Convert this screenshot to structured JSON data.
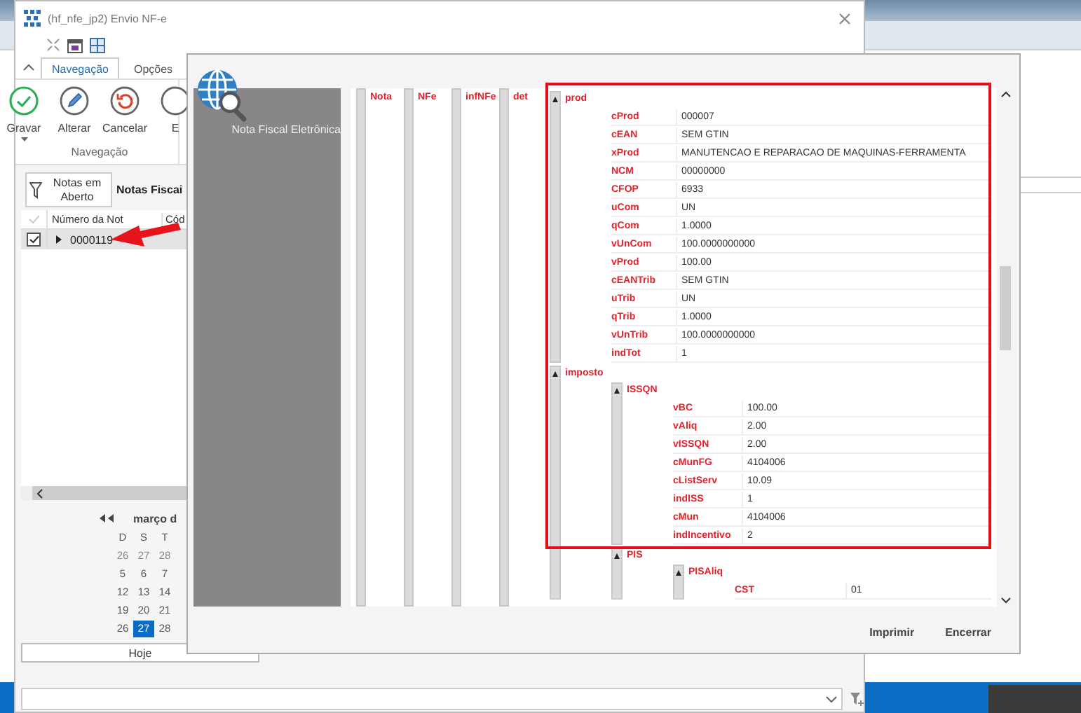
{
  "app_window": {
    "title": "(hf_nfe_jp2)  Envio NF-e"
  },
  "ribbon": {
    "tabs": [
      {
        "label": "Navegação",
        "selected": true
      },
      {
        "label": "Opções",
        "selected": false
      }
    ],
    "buttons": [
      {
        "label": "Gravar",
        "kind": "check",
        "dropdown": true
      },
      {
        "label": "Alterar",
        "kind": "pencil",
        "dropdown": false
      },
      {
        "label": "Cancelar",
        "kind": "undo",
        "dropdown": false
      },
      {
        "label": "E",
        "kind": "circle",
        "dropdown": false
      }
    ],
    "group_label": "Navegação"
  },
  "filter_button": "Notas em Aberto",
  "grid": {
    "title": "Notas Fiscai",
    "columns": [
      "Número da Not",
      "Cód"
    ],
    "rows": [
      {
        "checked": true,
        "selected": true,
        "number": "0000119"
      }
    ]
  },
  "calendar": {
    "month": "março d",
    "weekdays": [
      "D",
      "S",
      "T"
    ],
    "weeks": [
      [
        {
          "day": "26",
          "other_month": true,
          "selected": false
        },
        {
          "day": "27",
          "other_month": true,
          "selected": false
        },
        {
          "day": "28",
          "other_month": true,
          "selected": false
        }
      ],
      [
        {
          "day": "5",
          "other_month": false,
          "selected": false
        },
        {
          "day": "6",
          "other_month": false,
          "selected": false
        },
        {
          "day": "7",
          "other_month": false,
          "selected": false
        }
      ],
      [
        {
          "day": "12",
          "other_month": false,
          "selected": false
        },
        {
          "day": "13",
          "other_month": false,
          "selected": false
        },
        {
          "day": "14",
          "other_month": false,
          "selected": false
        }
      ],
      [
        {
          "day": "19",
          "other_month": false,
          "selected": false
        },
        {
          "day": "20",
          "other_month": false,
          "selected": false
        },
        {
          "day": "21",
          "other_month": false,
          "selected": false
        }
      ],
      [
        {
          "day": "26",
          "other_month": false,
          "selected": false
        },
        {
          "day": "27",
          "other_month": false,
          "selected": true
        },
        {
          "day": "28",
          "other_month": false,
          "selected": false
        }
      ]
    ]
  },
  "today_button": "Hoje",
  "dialog": {
    "heading": "Nota Fiscal Eletrônica",
    "path": [
      "Nota",
      "NFe",
      "infNFe",
      "det"
    ],
    "tree": [
      {
        "name": "prod",
        "expanded": true,
        "fields": [
          {
            "key": "cProd",
            "value": "000007"
          },
          {
            "key": "cEAN",
            "value": "SEM GTIN"
          },
          {
            "key": "xProd",
            "value": "MANUTENCAO E REPARACAO DE MAQUINAS-FERRAMENTA"
          },
          {
            "key": "NCM",
            "value": "00000000"
          },
          {
            "key": "CFOP",
            "value": "6933"
          },
          {
            "key": "uCom",
            "value": "UN"
          },
          {
            "key": "qCom",
            "value": "1.0000"
          },
          {
            "key": "vUnCom",
            "value": "100.0000000000"
          },
          {
            "key": "vProd",
            "value": "100.00"
          },
          {
            "key": "cEANTrib",
            "value": "SEM GTIN"
          },
          {
            "key": "uTrib",
            "value": "UN"
          },
          {
            "key": "qTrib",
            "value": "1.0000"
          },
          {
            "key": "vUnTrib",
            "value": "100.0000000000"
          },
          {
            "key": "indTot",
            "value": "1"
          }
        ]
      },
      {
        "name": "imposto",
        "expanded": true,
        "children": [
          {
            "name": "ISSQN",
            "expanded": true,
            "fields": [
              {
                "key": "vBC",
                "value": "100.00"
              },
              {
                "key": "vAliq",
                "value": "2.00"
              },
              {
                "key": "vISSQN",
                "value": "2.00"
              },
              {
                "key": "cMunFG",
                "value": "4104006"
              },
              {
                "key": "cListServ",
                "value": "10.09"
              },
              {
                "key": "indISS",
                "value": "1"
              },
              {
                "key": "cMun",
                "value": "4104006"
              },
              {
                "key": "indIncentivo",
                "value": "2"
              }
            ]
          },
          {
            "name": "PIS",
            "expanded": true,
            "children": [
              {
                "name": "PISAliq",
                "expanded": true,
                "fields": [
                  {
                    "key": "CST",
                    "value": "01"
                  }
                ]
              }
            ]
          }
        ]
      }
    ],
    "buttons": [
      "Imprimir",
      "Encerrar"
    ]
  }
}
